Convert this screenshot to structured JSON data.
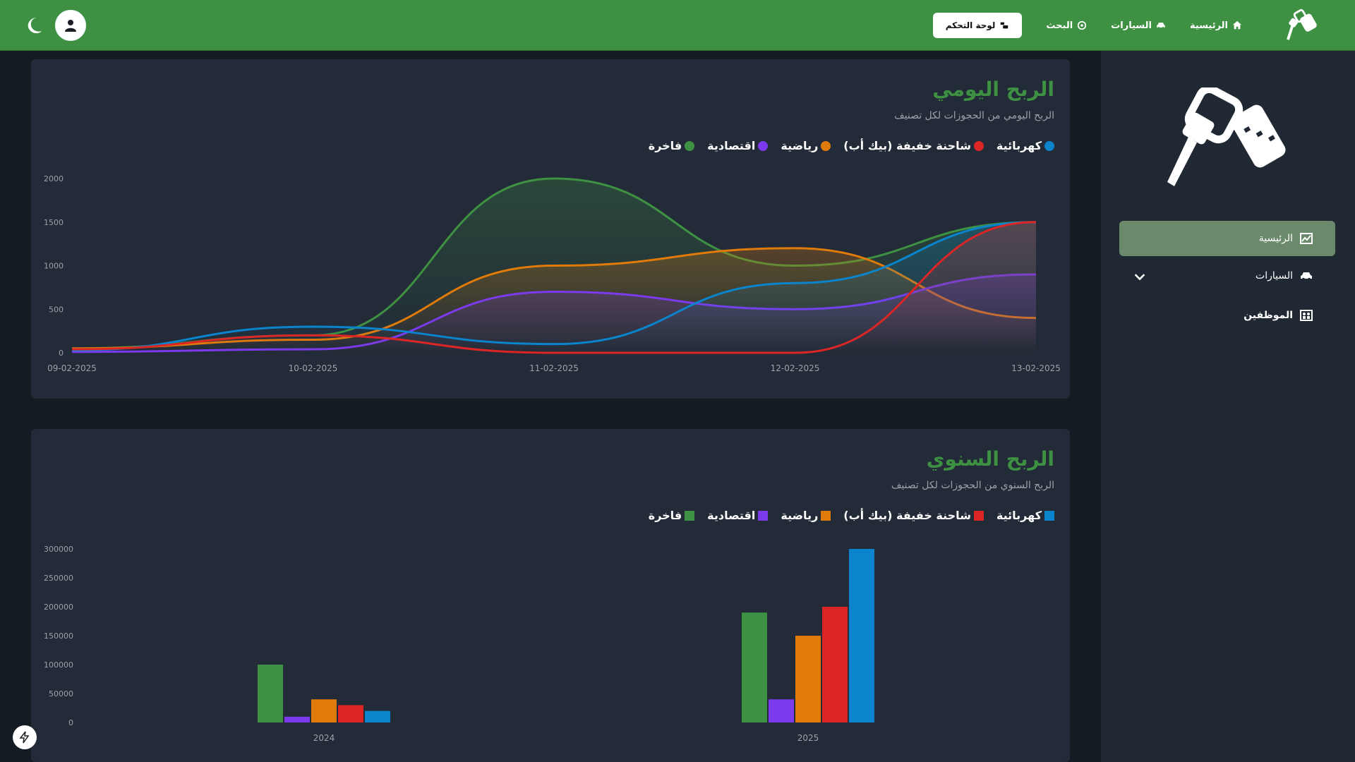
{
  "nav": {
    "home": "الرئيسية",
    "cars": "السيارات",
    "search": "البحث",
    "dashboard": "لوحة التحكم"
  },
  "sidebar": {
    "items": [
      {
        "label": "الرئيسية",
        "icon": "chart-icon",
        "active": true
      },
      {
        "label": "السيارات",
        "icon": "car-icon",
        "active": false
      },
      {
        "label": "الموظفين",
        "icon": "users-icon",
        "active": false
      }
    ]
  },
  "colors": {
    "brand": "#3e9142",
    "fakhra": "#3e9142",
    "iqtisadia": "#7c3aed",
    "riyadia": "#e07b0a",
    "pickup": "#dc2626",
    "kahraba": "#0a84cc"
  },
  "daily": {
    "title": "الربح اليومي",
    "subtitle": "الربح اليومي من الحجوزات لكل تصنيف"
  },
  "yearly": {
    "title": "الربح السنوي",
    "subtitle": "الربح السنوي من الحجوزات لكل تصنيف"
  },
  "chart_data": [
    {
      "type": "area",
      "x": [
        "09-02-2025",
        "10-02-2025",
        "11-02-2025",
        "12-02-2025",
        "13-02-2025"
      ],
      "ylim": [
        0,
        2000
      ],
      "yticks": [
        0,
        500,
        1000,
        1500,
        2000
      ],
      "legend_position": "top-right",
      "series": [
        {
          "name": "كهربائية",
          "color": "#0a84cc",
          "values": [
            30,
            300,
            100,
            800,
            1500
          ]
        },
        {
          "name": "شاحنة خفيفة (بيك أب)",
          "color": "#dc2626",
          "values": [
            40,
            200,
            0,
            0,
            1500
          ]
        },
        {
          "name": "رياضية",
          "color": "#e07b0a",
          "values": [
            50,
            150,
            1000,
            1200,
            400
          ]
        },
        {
          "name": "اقتصادية",
          "color": "#7c3aed",
          "values": [
            10,
            40,
            700,
            500,
            900
          ]
        },
        {
          "name": "فاخرة",
          "color": "#3e9142",
          "values": [
            50,
            200,
            2000,
            1000,
            1500
          ]
        }
      ]
    },
    {
      "type": "bar",
      "categories": [
        "2024",
        "2025"
      ],
      "ylim": [
        0,
        300000
      ],
      "yticks": [
        0,
        50000,
        100000,
        150000,
        200000,
        250000,
        300000
      ],
      "legend_position": "top-right",
      "series": [
        {
          "name": "فاخرة",
          "color": "#3e9142",
          "values": [
            100000,
            190000
          ]
        },
        {
          "name": "اقتصادية",
          "color": "#7c3aed",
          "values": [
            10000,
            40000
          ]
        },
        {
          "name": "رياضية",
          "color": "#e07b0a",
          "values": [
            40000,
            150000
          ]
        },
        {
          "name": "شاحنة خفيفة (بيك أب)",
          "color": "#dc2626",
          "values": [
            30000,
            200000
          ]
        },
        {
          "name": "كهربائية",
          "color": "#0a84cc",
          "values": [
            20000,
            300000
          ]
        }
      ],
      "legend_order": [
        "كهربائية",
        "شاحنة خفيفة (بيك أب)",
        "رياضية",
        "اقتصادية",
        "فاخرة"
      ]
    }
  ]
}
